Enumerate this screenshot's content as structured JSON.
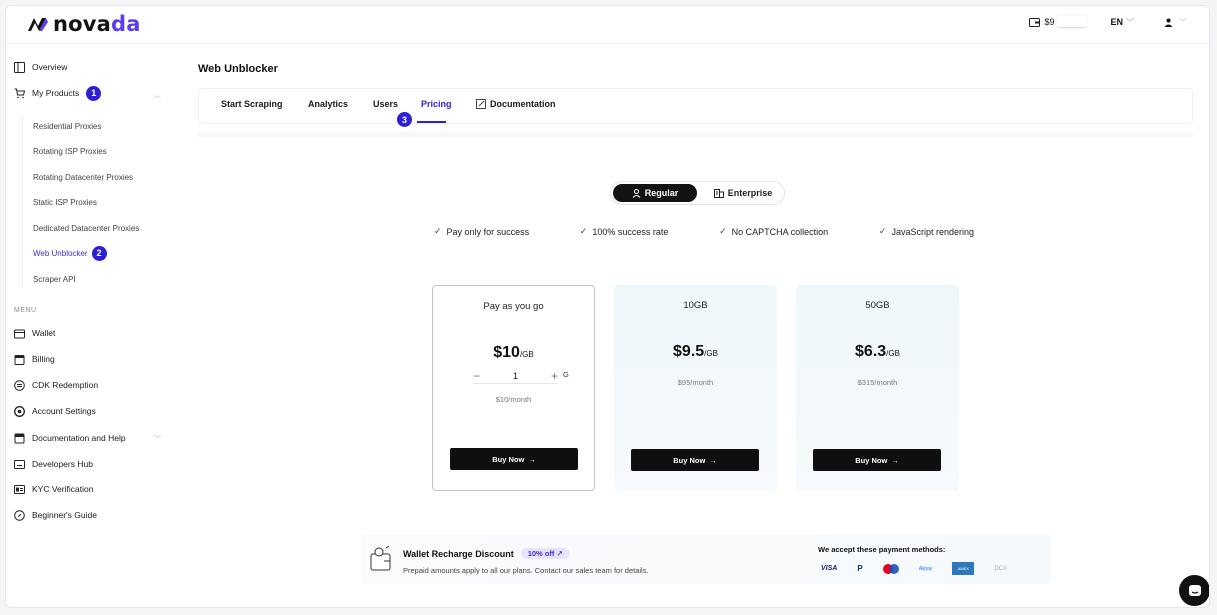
{
  "header": {
    "logo_text_a": "nova",
    "logo_text_b": "da",
    "balance": "$9",
    "language": "EN"
  },
  "sidebar": {
    "overview": "Overview",
    "my_products": "My Products",
    "my_products_badge": "1",
    "sub_items": [
      "Residential Proxies",
      "Rotating ISP Proxies",
      "Rotating Datacenter Proxies",
      "Static ISP Proxies",
      "Dedicated Datacenter Proxies",
      "Web Unblocker",
      "Scraper API"
    ],
    "web_unblocker_badge": "2",
    "menu_caption": "MENU",
    "menu_items": [
      "Wallet",
      "Billing",
      "CDK Redemption",
      "Account Settings",
      "Documentation and Help",
      "Developers Hub",
      "KYC Verification",
      "Beginner's Guide"
    ]
  },
  "main": {
    "title": "Web Unblocker",
    "tabs": [
      "Start Scraping",
      "Analytics",
      "Users",
      "Pricing",
      "Documentation"
    ],
    "pricing_badge": "3",
    "toggle": {
      "regular": "Regular",
      "enterprise": "Enterprise"
    },
    "features": [
      "Pay only for success",
      "100% success rate",
      "No CAPTCHA collection",
      "JavaScript rendering"
    ],
    "cards": [
      {
        "name": "Pay as you go",
        "price": "$10",
        "unit": "/GB",
        "quantity": "1",
        "qty_unit": "G",
        "monthly": "$10/month",
        "cta": "Buy Now"
      },
      {
        "name": "10GB",
        "price": "$9.5",
        "unit": "/GB",
        "monthly": "$95/month",
        "cta": "Buy Now"
      },
      {
        "name": "50GB",
        "price": "$6.3",
        "unit": "/GB",
        "monthly": "$315/month",
        "cta": "Buy Now"
      }
    ]
  },
  "promo": {
    "title": "Wallet Recharge Discount",
    "pill": "10% off ↗",
    "desc": "Prepaid amounts apply to all our plans. Contact our sales team for details.",
    "pay_title": "We accept these payment methods:",
    "methods": [
      "VISA",
      "P",
      "",
      "Alipay",
      "AMEX",
      "DCX"
    ]
  },
  "colors": {
    "accent": "#2d1fd6",
    "dark": "#111111"
  }
}
